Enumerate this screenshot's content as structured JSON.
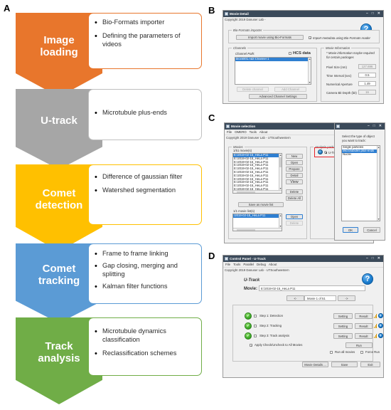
{
  "panels": {
    "a": "A",
    "b": "B",
    "c": "C",
    "d": "D"
  },
  "flowchart": {
    "stages": [
      {
        "title_line1": "Image",
        "title_line2": "loading",
        "color": "#E8762C",
        "border": "#E8762C",
        "bullets": [
          "Bio-Formats importer",
          "Defining the parameters of videos"
        ]
      },
      {
        "title_line1": "U-track",
        "title_line2": "",
        "color": "#A6A6A6",
        "border": "#BFBFBF",
        "bullets": [
          "Microtubule plus-ends"
        ]
      },
      {
        "title_line1": "Comet",
        "title_line2": "detection",
        "color": "#FFC000",
        "border": "#FFC000",
        "bullets": [
          "Difference of gaussian filter",
          "Watershed segmentation"
        ]
      },
      {
        "title_line1": "Comet",
        "title_line2": "tracking",
        "color": "#5B9BD5",
        "border": "#5B9BD5",
        "bullets": [
          "Frame to frame linking",
          "Gap closing, merging and splitting",
          "Kalman filter functions"
        ]
      },
      {
        "title_line1": "Track",
        "title_line2": "analysis",
        "color": "#70AD47",
        "border": "#70AD47",
        "bullets": [
          "Microtubule dynamics classification",
          "Reclassification schemes"
        ]
      }
    ]
  },
  "movie_detail": {
    "title": "Movie Detail",
    "copyright": "Copyright 2019 Danuser Lab -",
    "help_glyph": "?",
    "minimize": "–",
    "maximize": "□",
    "close": "✕",
    "bioformats_group": "Bio-Formats importer",
    "import_button": "Import movie using Bio-Formats",
    "import_metadata_checkbox": "Import metadata using Bio-Formats reader",
    "import_metadata_checked": true,
    "channels_group": "Channels",
    "channel_path_label": "Channel Path:",
    "hcs_data_label": "HCS data",
    "hcs_checked": false,
    "channel_items": [
      "block001.nd2:Channel 1"
    ],
    "delete_channel": "Delete channel",
    "add_channel": "Add Channel",
    "advanced_settings": "Advanced Channel Settings",
    "movie_info_group": "Movie Information",
    "movie_info_note": "* Movie information maybe required for certain packages",
    "fields": [
      {
        "label": "Pixel Size (nm)",
        "value": "127.696",
        "readonly": true
      },
      {
        "label": "Time Interval (sec)",
        "value": "0.5",
        "readonly": false
      },
      {
        "label": "Numerical Aperture",
        "value": "1.49",
        "readonly": false
      },
      {
        "label": "Camera Bit Depth (bit)",
        "value": "16",
        "readonly": true
      }
    ]
  },
  "movie_selection": {
    "title": "Movie selection",
    "menus": [
      "File",
      "OMERO",
      "Tools",
      "About"
    ],
    "copyright": "Copyright 2019 Danuser Lab - UTSouthwestern",
    "movies_group": "Movies",
    "movies_count": "1/51 movie(s)",
    "movie_rows": [
      "E:\\2019-02-15_HeLa P11",
      "E:\\2019-02-15_HeLa P11",
      "E:\\2019-02-15_HeLa P11",
      "E:\\2019-02-15_HeLa P11",
      "E:\\2019-02-15_HeLa P11",
      "E:\\2019-02-15_HeLa P11",
      "E:\\2019-02-15_HeLa P11",
      "E:\\2019-02-15_HeLa P11",
      "E:\\2019-02-15_HeLa P11",
      "E:\\2019-02-15_HeLa P11",
      "E:\\2019-02-15_HeLa P11"
    ],
    "movie_buttons_top": [
      "New",
      "Open",
      "Prepare",
      "Detail",
      "View"
    ],
    "movie_buttons_bottom": [
      "Delete",
      "Delete All"
    ],
    "save_as_movie_list": "Save as movie list",
    "movie_lists_count": "1/1 movie list(s)",
    "movie_list_rows": [
      "\\2019-02-15_HeLa P11"
    ],
    "list_buttons": [
      "Open",
      "Delete"
    ],
    "analysis_packages_group": "Analysis packages",
    "package_label": "U-Track",
    "package_selected": true
  },
  "object_type_dialog": {
    "minimize": "–",
    "maximize": "□",
    "close": "✕",
    "prompt_line1": "Select the type of object",
    "prompt_line2": "you want to track:",
    "options": [
      "Single particles",
      "Microtubules plus-ends",
      "Nuclei"
    ],
    "selected_index": 1,
    "ok": "OK",
    "cancel": "Cancel"
  },
  "control_panel": {
    "title": "Control Panel - U-Track",
    "menus": [
      "File",
      "Tools",
      "Parallel",
      "Debug",
      "About"
    ],
    "copyright": "Copyright 2019 Danuser Lab - UTSouthwestern",
    "package_name": "U-Track",
    "movie_label": "Movie:",
    "movie_path": "E:\\2019-02-15_HeLa P11",
    "prev_button": "<-",
    "next_button": "->",
    "movie_selector": "Movie 1 of 51",
    "steps": [
      {
        "label": "Step 1: Detection",
        "done": true,
        "checked": false
      },
      {
        "label": "Step 2: Tracking",
        "done": true,
        "checked": false
      },
      {
        "label": "Step 3: Track analysis",
        "done": true,
        "checked": false
      }
    ],
    "setting_button": "Setting",
    "result_button": "Result",
    "help_glyph": "?",
    "apply_all_label": "Apply Check/Uncheck to All Movies",
    "apply_all_checked": true,
    "run_button": "Run",
    "run_all_movies": "Run all movies",
    "force_run": "Force Run",
    "movie_details_button": "Movie Details ...",
    "save_button": "Save",
    "exit_button": "Exit"
  }
}
